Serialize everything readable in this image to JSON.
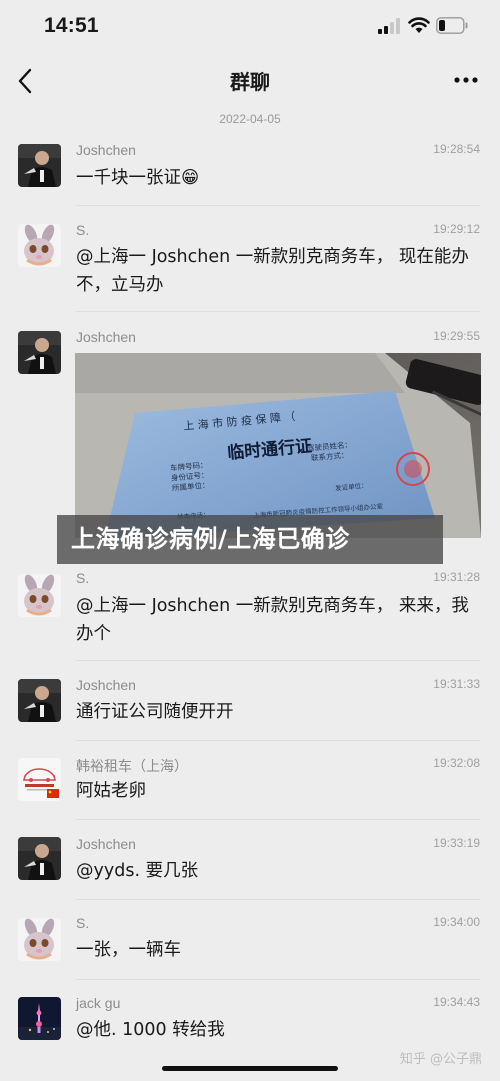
{
  "status_bar": {
    "time": "14:51"
  },
  "nav": {
    "title": "群聊"
  },
  "date_separator": "2022-04-05",
  "messages": [
    {
      "sender": "Joshchen",
      "time": "19:28:54",
      "text": "一千块一张证😁"
    },
    {
      "sender": "S.",
      "time": "19:29:12",
      "text": "@上海一 Joshchen 一新款别克商务车， 现在能办不，立马办"
    },
    {
      "sender": "Joshchen",
      "time": "19:29:55",
      "text": ""
    },
    {
      "sender": "S.",
      "time": "19:31:28",
      "text": "@上海一 Joshchen 一新款别克商务车， 来来，我办个"
    },
    {
      "sender": "Joshchen",
      "time": "19:31:33",
      "text": "通行证公司随便开开"
    },
    {
      "sender": "韩裕租车（上海）",
      "time": "19:32:08",
      "text": "阿姑老卵"
    },
    {
      "sender": "Joshchen",
      "time": "19:33:19",
      "text": "@yyds. 要几张"
    },
    {
      "sender": "S.",
      "time": "19:34:00",
      "text": "一张，一辆车"
    },
    {
      "sender": "jack gu",
      "time": "19:34:43",
      "text": "@他. 1000 转给我"
    }
  ],
  "photo": {
    "title_line1": "上 海 市 防 疫 保 障 （",
    "title_line2": "临时通行证",
    "field1": "车牌号码：",
    "field2": "身份证号：",
    "field3": "所属单位：",
    "field_r1": "驾驶员姓名：",
    "field_r2": "联系方式：",
    "footer": "上海市新冠肺炎疫情防控工作领导小组办公室",
    "footer_left": "林本电话：",
    "stamp_label": "发证单位：",
    "stamp_color": "#d8454a",
    "card_color": "#8aaed8"
  },
  "overlay_caption": "上海确诊病例/上海已确诊",
  "watermark": "知乎 @公子鼎"
}
